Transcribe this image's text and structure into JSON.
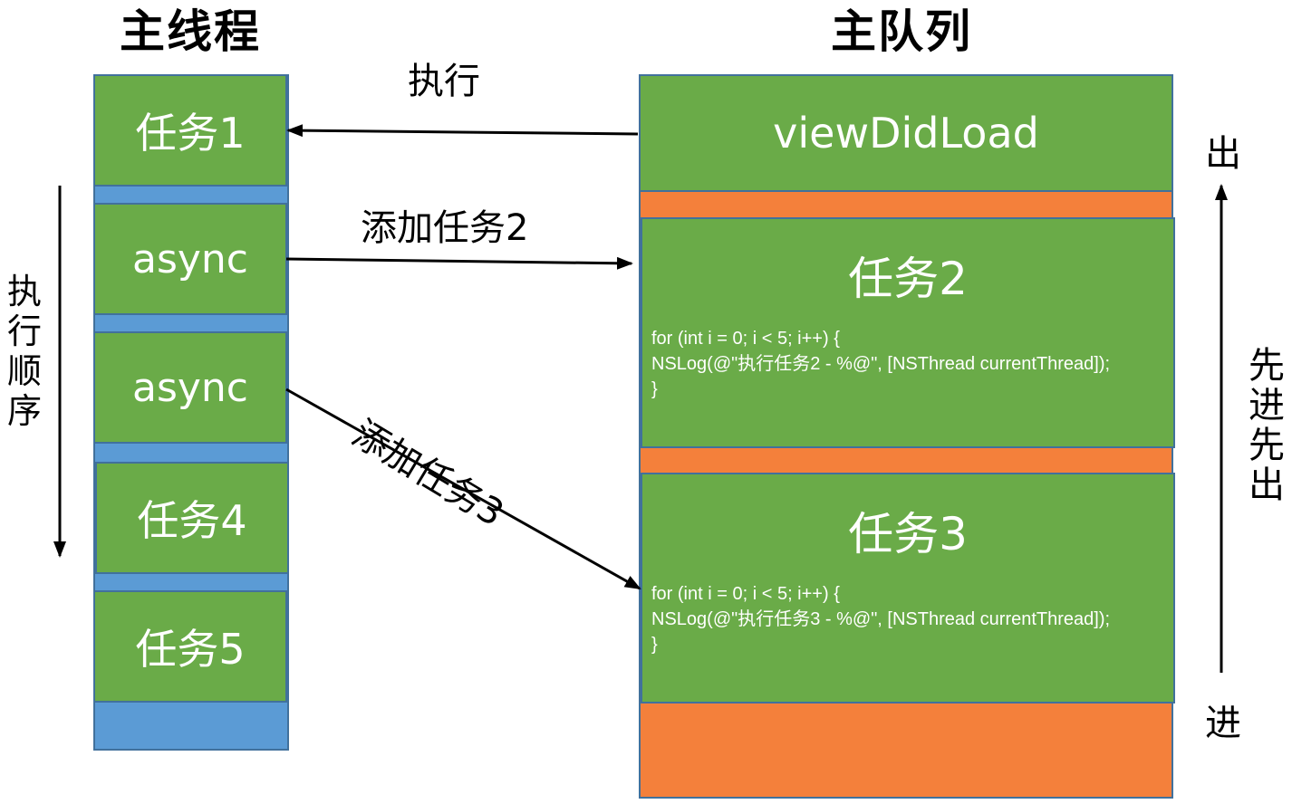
{
  "main_thread": {
    "title": "主线程",
    "order_label": [
      "执",
      "行",
      "顺",
      "序"
    ],
    "blocks": [
      {
        "label": "任务1"
      },
      {
        "label": "async"
      },
      {
        "label": "async"
      },
      {
        "label": "任务4"
      },
      {
        "label": "任务5"
      }
    ]
  },
  "main_queue": {
    "title": "主队列",
    "items": [
      {
        "label": "viewDidLoad"
      },
      {
        "label": "任务2",
        "code": [
          "for (int i = 0; i < 5; i++) {",
          "NSLog(@\"执行任务2 - %@\", [NSThread currentThread]);",
          "}"
        ]
      },
      {
        "label": "任务3",
        "code": [
          "for (int i = 0; i < 5; i++) {",
          "NSLog(@\"执行任务3 - %@\", [NSThread currentThread]);",
          "}"
        ]
      }
    ],
    "out_label": "出",
    "in_label": "进",
    "fifo_label": [
      "先",
      "进",
      "先",
      "出"
    ]
  },
  "arrows": {
    "execute": "执行",
    "add_task2": "添加任务2",
    "add_task3": "添加任务3"
  },
  "colors": {
    "task_green": "#6aab48",
    "thread_blue": "#5b9bd5",
    "queue_orange": "#f4803b",
    "border": "#41719c"
  }
}
